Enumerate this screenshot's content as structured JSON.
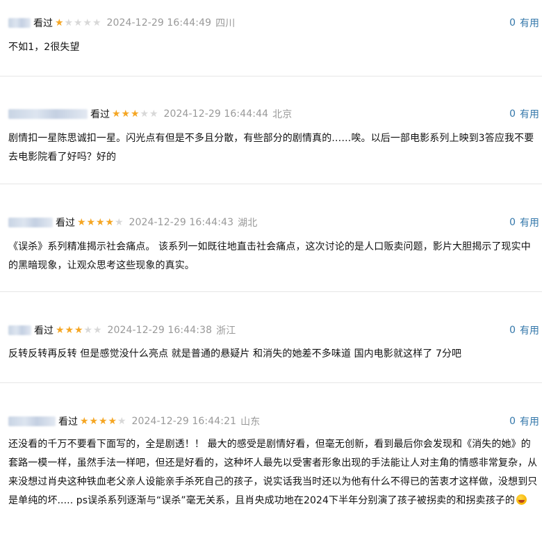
{
  "reviews": [
    {
      "status": "看过",
      "rating": 1,
      "time": "2024-12-29 16:44:49",
      "location": "四川",
      "useful_count": "0",
      "useful_label": "有用",
      "content": "不如1，2很失望"
    },
    {
      "status": "看过",
      "rating": 3,
      "time": "2024-12-29 16:44:44",
      "location": "北京",
      "useful_count": "0",
      "useful_label": "有用",
      "content": "剧情扣一星陈思诚扣一星。闪光点有但是不多且分散，有些部分的剧情真的……唉。以后一部电影系列上映到3答应我不要去电影院看了好吗？好的"
    },
    {
      "status": "看过",
      "rating": 4,
      "time": "2024-12-29 16:44:43",
      "location": "湖北",
      "useful_count": "0",
      "useful_label": "有用",
      "content": "《误杀》系列精准揭示社会痛点。 该系列一如既往地直击社会痛点，这次讨论的是人口贩卖问题，影片大胆揭示了现实中的黑暗现象，让观众思考这些现象的真实。"
    },
    {
      "status": "看过",
      "rating": 3,
      "time": "2024-12-29 16:44:38",
      "location": "浙江",
      "useful_count": "0",
      "useful_label": "有用",
      "content": "反转反转再反转 但是感觉没什么亮点 就是普通的悬疑片 和消失的她差不多味道 国内电影就这样了 7分吧"
    },
    {
      "status": "看过",
      "rating": 4,
      "time": "2024-12-29 16:44:21",
      "location": "山东",
      "useful_count": "0",
      "useful_label": "有用",
      "content": "还没看的千万不要看下面写的，全是剧透！！ 最大的感受是剧情好看，但毫无创新，看到最后你会发现和《消失的她》的套路一模一样，虽然手法一样吧，但还是好看的，这种坏人最先以受害者形象出现的手法能让人对主角的情感非常复杂，从来没想过肖央这种铁血老父亲人设能亲手杀死自己的孩子，说实话我当时还以为他有什么不得已的苦衷才这样做，没想到只是单纯的坏..... ps误杀系列逐渐与“误杀”毫无关系，且肖央成功地在2024下半年分别演了孩子被拐卖的和拐卖孩子的",
      "emoji": "rolling-on-floor-laughing-emoji"
    }
  ]
}
